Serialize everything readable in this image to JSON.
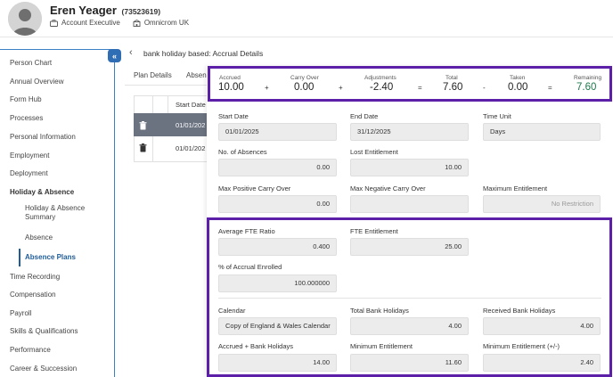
{
  "employee": {
    "name": "Eren Yeager",
    "id": "(73523619)",
    "role": "Account Executive",
    "company": "Omnicrom UK"
  },
  "sidebar": {
    "items": [
      {
        "label": "Person Chart"
      },
      {
        "label": "Annual Overview"
      },
      {
        "label": "Form Hub"
      },
      {
        "label": "Processes"
      },
      {
        "label": "Personal Information"
      },
      {
        "label": "Employment"
      },
      {
        "label": "Deployment"
      },
      {
        "label": "Holiday & Absence"
      },
      {
        "label": "Holiday & Absence Summary"
      },
      {
        "label": "Absence"
      },
      {
        "label": "Absence Plans"
      },
      {
        "label": "Time Recording"
      },
      {
        "label": "Compensation"
      },
      {
        "label": "Payroll"
      },
      {
        "label": "Skills & Qualifications"
      },
      {
        "label": "Performance"
      },
      {
        "label": "Career & Succession"
      }
    ],
    "collapse_glyph": "«"
  },
  "main": {
    "back_glyph": "‹",
    "title": "bank holiday based: Accrual Details",
    "tabs": [
      {
        "label": "Plan Details"
      },
      {
        "label": "Absen"
      }
    ],
    "table": {
      "column_header": "Start Date",
      "rows": [
        {
          "start": "01/01/202"
        },
        {
          "start": "01/01/202"
        }
      ]
    }
  },
  "summary": {
    "accrued": {
      "label": "Accrued",
      "value": "10.00"
    },
    "carry_over": {
      "label": "Carry Over",
      "value": "0.00"
    },
    "adjustments": {
      "label": "Adjustments",
      "value": "-2.40"
    },
    "total": {
      "label": "Total",
      "value": "7.60"
    },
    "taken": {
      "label": "Taken",
      "value": "0.00"
    },
    "remaining": {
      "label": "Remaining",
      "value": "7.60"
    },
    "ops": [
      "+",
      "+",
      "=",
      "-",
      "="
    ],
    "remaining_color": "#1a7a4a",
    "highlight_color": "#5b1fa8"
  },
  "fields": {
    "start_date": {
      "label": "Start Date",
      "value": "01/01/2025"
    },
    "end_date": {
      "label": "End Date",
      "value": "31/12/2025"
    },
    "time_unit": {
      "label": "Time Unit",
      "value": "Days"
    },
    "no_absences": {
      "label": "No. of Absences",
      "value": "0.00"
    },
    "lost_entitlement": {
      "label": "Lost Entitlement",
      "value": "10.00"
    },
    "max_pos_carry": {
      "label": "Max Positive Carry Over",
      "value": "0.00"
    },
    "max_neg_carry": {
      "label": "Max Negative Carry Over",
      "value": ""
    },
    "max_entitlement": {
      "label": "Maximum Entitlement",
      "value": "No Restriction"
    },
    "avg_fte": {
      "label": "Average FTE Ratio",
      "value": "0.400"
    },
    "fte_entitlement": {
      "label": "FTE Entitlement",
      "value": "25.00"
    },
    "pct_accrual": {
      "label": "% of Accrual Enrolled",
      "value": "100.000000"
    },
    "calendar": {
      "label": "Calendar",
      "value": "Copy of England & Wales Calendar"
    },
    "total_bank_hol": {
      "label": "Total Bank Holidays",
      "value": "4.00"
    },
    "received_bank_hol": {
      "label": "Received Bank Holidays",
      "value": "4.00"
    },
    "accrued_bank_hol": {
      "label": "Accrued + Bank Holidays",
      "value": "14.00"
    },
    "min_entitlement": {
      "label": "Minimum Entitlement",
      "value": "11.60"
    },
    "min_entitlement_pm": {
      "label": "Minimum Entitlement (+/-)",
      "value": "2.40"
    }
  }
}
